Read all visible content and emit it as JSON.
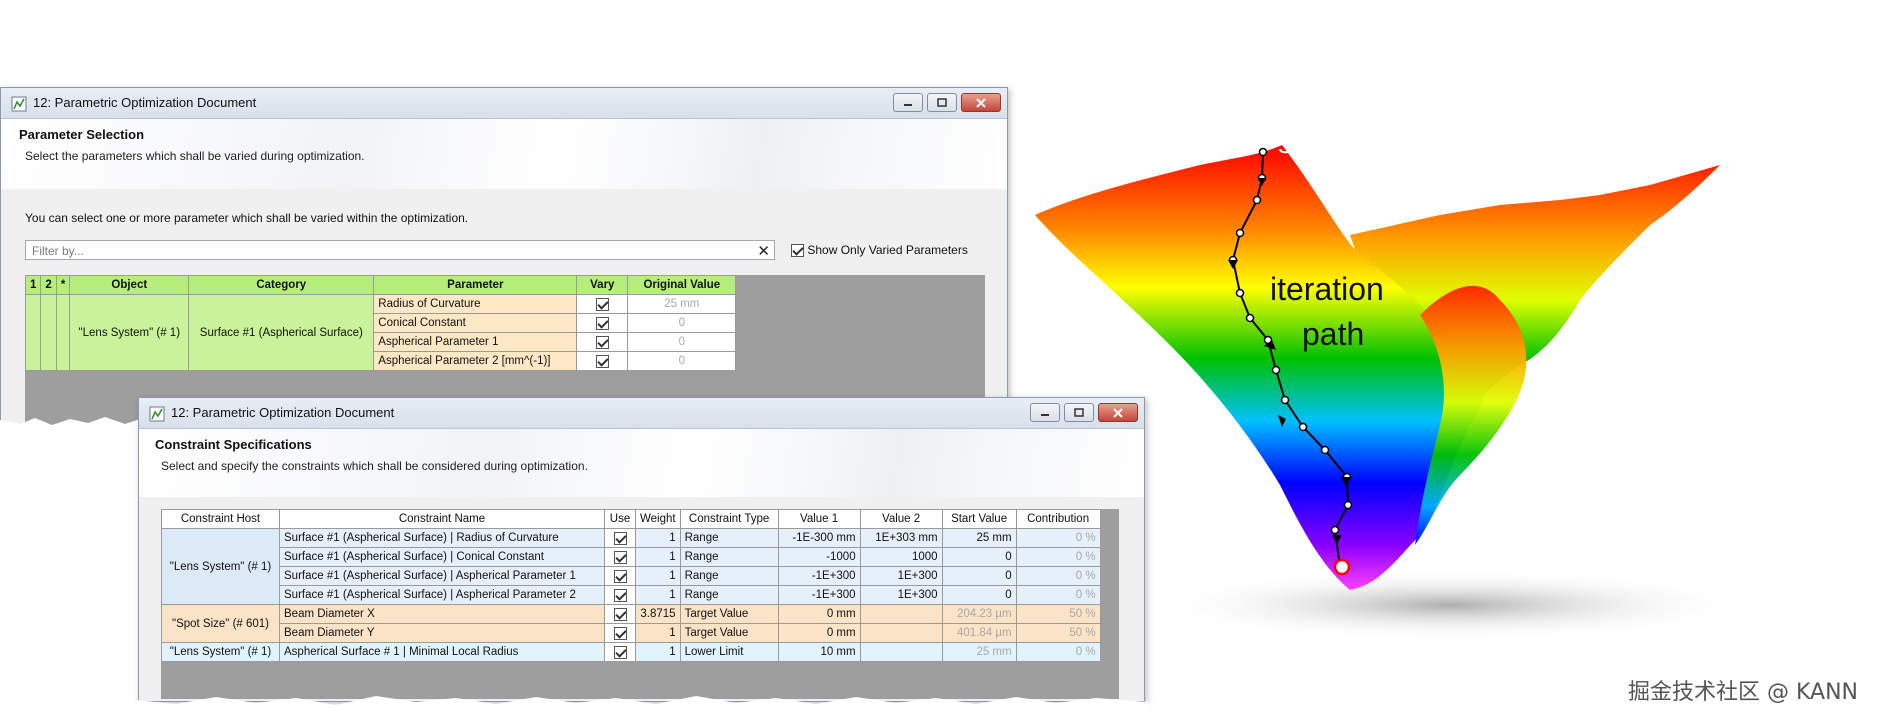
{
  "window1": {
    "title": "12: Parametric Optimization Document",
    "section_title": "Parameter Selection",
    "section_desc": "Select the parameters which shall be varied during optimization.",
    "info": "You can select one or more parameter which shall be varied within the optimization.",
    "filter_placeholder": "Filter by...",
    "filter_clear": "✕",
    "show_only_label": "Show Only Varied Parameters",
    "columns": [
      "1",
      "2",
      "*",
      "Object",
      "Category",
      "Parameter",
      "Vary",
      "Original Value"
    ],
    "object": "\"Lens System\" (# 1)",
    "category": "Surface #1 (Aspherical Surface)",
    "rows": [
      {
        "parameter": "Radius of Curvature",
        "vary": true,
        "original": "25 mm"
      },
      {
        "parameter": "Conical Constant",
        "vary": true,
        "original": "0"
      },
      {
        "parameter": "Aspherical Parameter 1",
        "vary": true,
        "original": "0"
      },
      {
        "parameter": "Aspherical Parameter 2 [mm^(-1)]",
        "vary": true,
        "original": "0"
      }
    ]
  },
  "window2": {
    "title": "12: Parametric Optimization Document",
    "section_title": "Constraint Specifications",
    "section_desc": "Select and specify the constraints which shall be considered during optimization.",
    "columns": [
      "Constraint Host",
      "Constraint Name",
      "Use",
      "Weight",
      "Constraint Type",
      "Value 1",
      "Value 2",
      "Start Value",
      "Contribution"
    ],
    "groups": [
      {
        "host": "\"Lens System\" (# 1)",
        "rows": [
          {
            "name": "Surface #1 (Aspherical Surface) | Radius of Curvature",
            "use": true,
            "weight": "1",
            "type": "Range",
            "v1": "-1E-300 mm",
            "v2": "1E+303 mm",
            "start": "25 mm",
            "contribution": "0 %"
          },
          {
            "name": "Surface #1 (Aspherical Surface) | Conical Constant",
            "use": true,
            "weight": "1",
            "type": "Range",
            "v1": "-1000",
            "v2": "1000",
            "start": "0",
            "contribution": "0 %"
          },
          {
            "name": "Surface #1 (Aspherical Surface) | Aspherical Parameter 1",
            "use": true,
            "weight": "1",
            "type": "Range",
            "v1": "-1E+300",
            "v2": "1E+300",
            "start": "0",
            "contribution": "0 %"
          },
          {
            "name": "Surface #1 (Aspherical Surface) | Aspherical Parameter 2",
            "use": true,
            "weight": "1",
            "type": "Range",
            "v1": "-1E+300",
            "v2": "1E+300",
            "start": "0",
            "contribution": "0 %"
          }
        ]
      },
      {
        "host": "\"Spot Size\" (# 601)",
        "rows": [
          {
            "name": "Beam Diameter X",
            "use": true,
            "weight": "3.8715",
            "type": "Target Value",
            "v1": "0 mm",
            "v2": "",
            "start": "204.23 µm",
            "contribution": "50 %"
          },
          {
            "name": "Beam Diameter Y",
            "use": true,
            "weight": "1",
            "type": "Target Value",
            "v1": "0 mm",
            "v2": "",
            "start": "401.84 µm",
            "contribution": "50 %"
          }
        ]
      },
      {
        "host": "\"Lens System\" (# 1)",
        "rows": [
          {
            "name": "Aspherical Surface # 1 | Minimal Local Radius",
            "use": true,
            "weight": "1",
            "type": "Lower Limit",
            "v1": "10 mm",
            "v2": "",
            "start": "25 mm",
            "contribution": "0 %"
          }
        ]
      }
    ]
  },
  "surface_plot": {
    "label_start": "start",
    "label_iteration": "iteration",
    "label_path": "path"
  },
  "watermark": "掘金技术社区 @ KANN",
  "icons": {
    "title": "chart-document-icon",
    "minimize": "minimize-icon",
    "maximize": "maximize-icon",
    "close": "close-icon"
  }
}
